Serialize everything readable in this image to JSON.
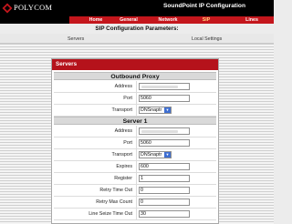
{
  "header": {
    "logo_text": "POLYCOM",
    "app_title": "SoundPoint IP Configuration",
    "nav": [
      {
        "label": "Home"
      },
      {
        "label": "General"
      },
      {
        "label": "Network"
      },
      {
        "label": "SIP"
      },
      {
        "label": "Lines"
      }
    ],
    "active_nav": "SIP"
  },
  "page": {
    "title": "SIP Configuration Parameters:",
    "subnav": [
      {
        "label": "Servers"
      },
      {
        "label": "Local Settings"
      }
    ]
  },
  "panel": {
    "title": "Servers",
    "outbound": {
      "heading": "Outbound Proxy",
      "address_label": "Address",
      "address_value": "",
      "port_label": "Port",
      "port_value": "5060",
      "transport_label": "Transport",
      "transport_value": "DNSnaptr"
    },
    "server1": {
      "heading": "Server 1",
      "address_label": "Address",
      "address_value": "",
      "port_label": "Port",
      "port_value": "5060",
      "transport_label": "Transport",
      "transport_value": "DNSnaptr",
      "expires_label": "Expires",
      "expires_value": "600",
      "register_label": "Register",
      "register_value": "1",
      "retry_timeout_label": "Retry Time Out",
      "retry_timeout_value": "0",
      "retry_max_label": "Retry Max Count",
      "retry_max_value": "0",
      "line_seize_label": "Line Seize Time Out",
      "line_seize_value": "30"
    }
  },
  "colors": {
    "brand_red": "#c4161c",
    "header_black": "#000000",
    "select_blue": "#3f6fd1"
  },
  "icons": {
    "logo": "polycom-logo-mark",
    "select_arrow": "chevron-down-icon"
  }
}
